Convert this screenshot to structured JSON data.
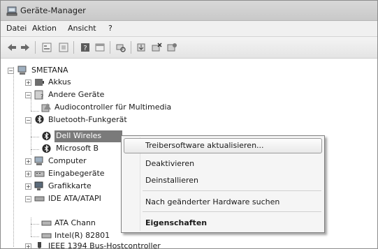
{
  "window": {
    "title": "Geräte-Manager",
    "title_icon": "device-manager-icon"
  },
  "menu": {
    "items": [
      "Datei",
      "Aktion",
      "Ansicht",
      "?"
    ]
  },
  "toolbar": {
    "buttons": [
      "back-arrow-icon",
      "forward-arrow-icon",
      "properties-view-icon",
      "window-view-icon",
      "help-icon",
      "pane-icon",
      "scan-hardware-icon",
      "update-driver-icon",
      "uninstall-icon",
      "disable-device-icon"
    ]
  },
  "tree": {
    "root": "SMETANA",
    "nodes": [
      {
        "label": "Akkus",
        "icon": "battery-icon",
        "expander": "+"
      },
      {
        "label": "Andere Geräte",
        "icon": "unknown-device-icon",
        "expander": "-"
      },
      {
        "label": "Audiocontroller für Multimedia",
        "icon": "warning-device-icon"
      },
      {
        "label": "Bluetooth-Funkgerät",
        "icon": "bluetooth-icon",
        "expander": "-"
      },
      {
        "label": "Dell Wireles",
        "icon": "bluetooth-icon"
      },
      {
        "label": "Microsoft B",
        "icon": "bluetooth-icon"
      },
      {
        "label": "Computer",
        "icon": "computer-icon",
        "expander": "+"
      },
      {
        "label": "Eingabegeräte",
        "icon": "input-device-icon",
        "expander": "+"
      },
      {
        "label": "Grafikkarte",
        "icon": "display-adapter-icon",
        "expander": "+"
      },
      {
        "label": "IDE ATA/ATAPI",
        "icon": "ide-controller-icon",
        "expander": "-"
      },
      {
        "label": "ATA Chann",
        "icon": "ide-channel-icon"
      },
      {
        "label": "Intel(R) 82801",
        "icon": "ide-channel-icon"
      },
      {
        "label": "IEEE 1394 Bus-Hostcontroller",
        "icon": "firewire-icon",
        "expander": "+"
      }
    ]
  },
  "context_menu": {
    "items": [
      "Treibersoftware aktualisieren...",
      "Deaktivieren",
      "Deinstallieren",
      "Nach geänderter Hardware suchen",
      "Eigenschaften"
    ]
  }
}
